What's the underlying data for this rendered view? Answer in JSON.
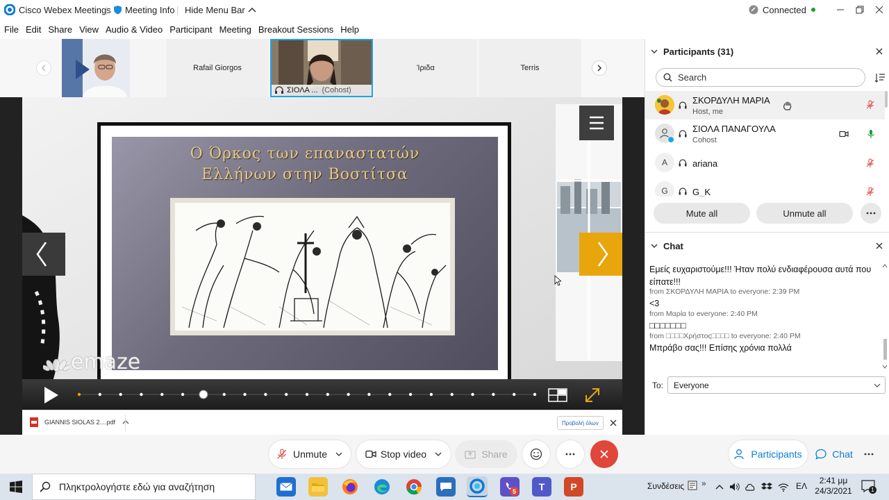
{
  "titlebar": {
    "app_title": "Cisco Webex Meetings",
    "meeting_info": "Meeting Info",
    "hide_menu": "Hide Menu Bar",
    "status": "Connected"
  },
  "menu": [
    "File",
    "Edit",
    "Share",
    "View",
    "Audio & Video",
    "Participant",
    "Meeting",
    "Breakout Sessions",
    "Help"
  ],
  "filmstrip": {
    "tiles": [
      {
        "label": ""
      },
      {
        "label": "Rafail Giorgos"
      },
      {
        "label": "ΣΙΟΛΑ ...",
        "sub": "(Cohost)"
      },
      {
        "label": "Ίριδα"
      },
      {
        "label": "Terris"
      }
    ]
  },
  "slide": {
    "title_line1": "Ο Όρκος των επαναστατών",
    "title_line2": "Ελλήνων στην Βοστίτσα",
    "brand": "emaze",
    "total_steps": 23,
    "current_step": 6
  },
  "download_bar": {
    "file": "GIANNIS SIOLAS 2....pdf",
    "show_all": "Προβολή όλων"
  },
  "participants": {
    "header": "Participants (31)",
    "search_placeholder": "Search",
    "list": [
      {
        "initial": "",
        "name": "ΣΚΟΡΔΥΛΗ ΜΑΡΙΑ",
        "role": "Host, me"
      },
      {
        "initial": "",
        "name": "ΣΙΟΛΑ ΠΑΝΑΓΟΥΛΑ",
        "role": "Cohost"
      },
      {
        "initial": "A",
        "name": "ariana",
        "role": ""
      },
      {
        "initial": "G",
        "name": "G_K",
        "role": ""
      }
    ],
    "mute_all": "Mute all",
    "unmute_all": "Unmute all"
  },
  "chat": {
    "header": "Chat",
    "messages": [
      {
        "text": "Εμείς ευχαριστούμε!!! Ήταν πολύ ενδιαφέρουσα αυτά που είπατε!!!",
        "meta": "from ΣΚΟΡΔΥΛΗ ΜΑΡΙΑ to everyone:    2:39 PM"
      },
      {
        "text": "<3",
        "meta": "from Μαρία  to everyone:    2:40 PM"
      },
      {
        "text": "□□□□□□□",
        "meta": "from □□□□Χρήστος□□□□ to everyone:    2:40 PM"
      },
      {
        "text": "Μπράβο σας!!! Επίσης χρόνια πολλά",
        "meta": ""
      }
    ],
    "to_label": "To:",
    "to_value": "Everyone"
  },
  "controls": {
    "unmute": "Unmute",
    "stop_video": "Stop video",
    "share": "Share",
    "participants": "Participants",
    "chat": "Chat"
  },
  "taskbar": {
    "search_placeholder": "Πληκτρολογήστε εδώ για αναζήτηση",
    "connections": "Συνδέσεις",
    "lang": "ΕΛ",
    "time": "2:41 μμ",
    "date": "24/3/2021",
    "badge": "5",
    "notif": "1"
  },
  "colors": {
    "accent": "#0a7bd6",
    "hangup": "#e0463a",
    "slide_next": "#e8a50c",
    "connected": "#1a9e3d"
  }
}
